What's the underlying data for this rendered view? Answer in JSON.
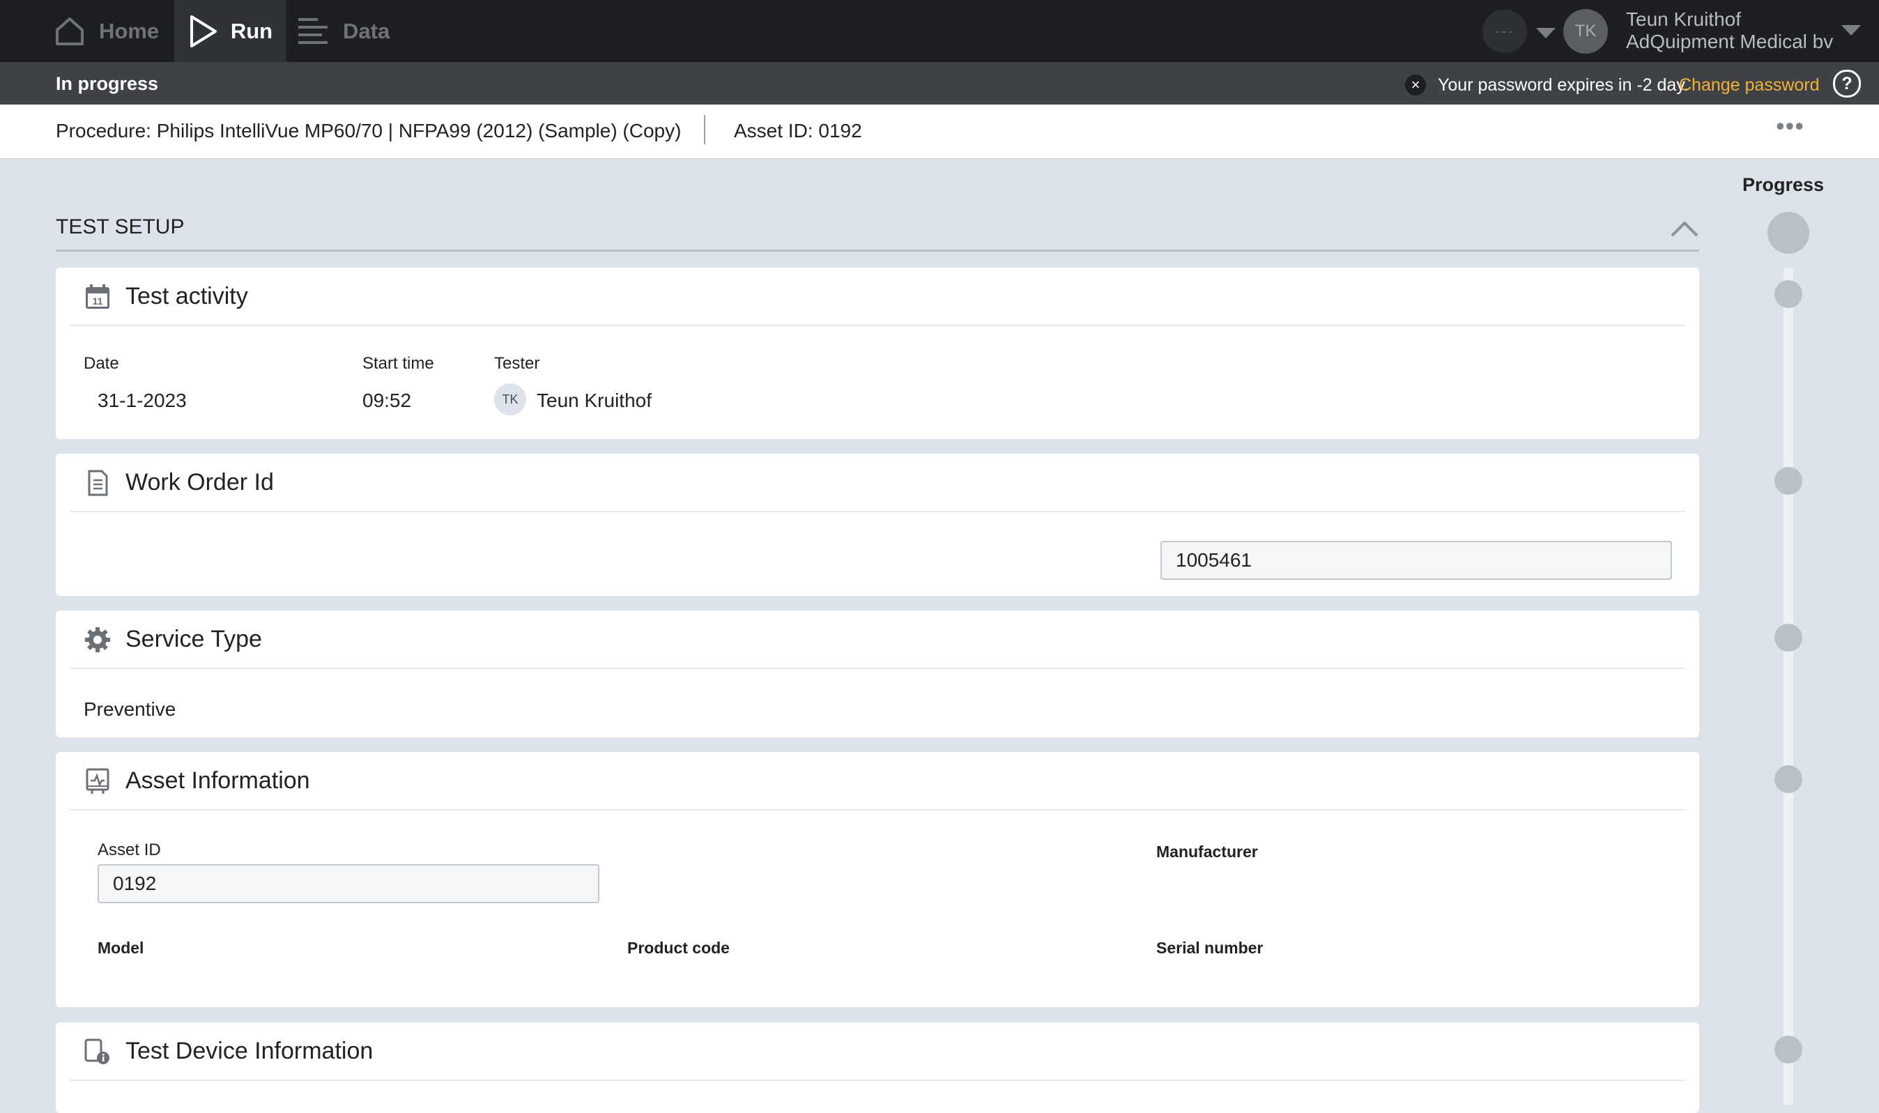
{
  "nav": {
    "home_label": "Home",
    "run_label": "Run",
    "data_label": "Data",
    "status_pill": "---",
    "user_initials": "TK",
    "user_name": "Teun Kruithof",
    "user_org": "AdQuipment Medical bv"
  },
  "status_bar": {
    "title": "In progress",
    "password_message": "Your password expires in -2 day.",
    "change_password_link": "Change password",
    "help_icon": "?"
  },
  "procedure_bar": {
    "procedure": "Procedure: Philips IntelliVue MP60/70 | NFPA99 (2012) (Sample) (Copy)",
    "asset": "Asset ID: 0192",
    "more": "•••"
  },
  "progress": {
    "title": "Progress"
  },
  "section": {
    "title": "TEST SETUP"
  },
  "test_activity": {
    "title": "Test activity",
    "icon": "calendar-icon",
    "date_label": "Date",
    "date_value": "31-1-2023",
    "start_time_label": "Start time",
    "start_time_value": "09:52",
    "tester_label": "Tester",
    "tester_initials": "TK",
    "tester_name": "Teun Kruithof"
  },
  "work_order": {
    "title": "Work Order Id",
    "icon": "document-icon",
    "value": "1005461"
  },
  "service_type": {
    "title": "Service Type",
    "icon": "gear-icon",
    "value": "Preventive"
  },
  "asset_info": {
    "title": "Asset Information",
    "icon": "monitor-icon",
    "asset_id_label": "Asset ID",
    "asset_id_value": "0192",
    "manufacturer_label": "Manufacturer",
    "model_label": "Model",
    "product_code_label": "Product code",
    "serial_number_label": "Serial number"
  },
  "test_device": {
    "title": "Test Device Information",
    "icon": "device-info-icon"
  },
  "colors": {
    "nav_bg": "#1d1f22",
    "status_bg": "#3e4247",
    "link_orange": "#f3b234",
    "page_bg": "#dde3ea"
  }
}
